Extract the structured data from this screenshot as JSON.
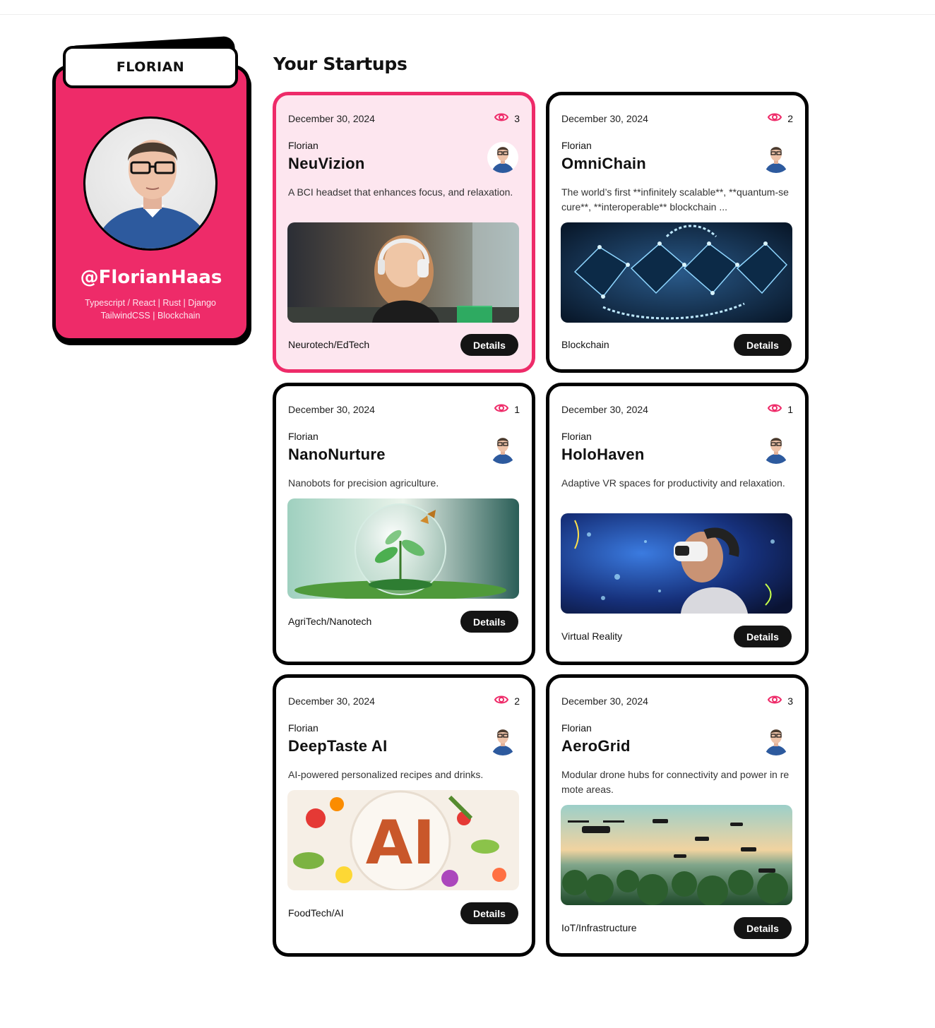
{
  "profile": {
    "tab_label": "FLORIAN",
    "handle": "@FlorianHaas",
    "bio_line1": "Typescript / React | Rust | Django",
    "bio_line2": "TailwindCSS | Blockchain",
    "avatar": "person-portrait"
  },
  "heading": "Your Startups",
  "details_label": "Details",
  "colors": {
    "accent": "#ee2b69",
    "accent_light": "#fde6ef",
    "button": "#141414"
  },
  "startups": [
    {
      "date": "December 30, 2024",
      "views": "3",
      "author": "Florian",
      "title": "NeuVizion",
      "description": "A BCI headset that enhances focus, and relaxation.",
      "category": "Neurotech/EdTech",
      "image": "woman-with-headphones",
      "active": true
    },
    {
      "date": "December 30, 2024",
      "views": "2",
      "author": "Florian",
      "title": "OmniChain",
      "description": "The world’s first **infinitely scalable**, **quantum-secure**, **interoperable** blockchain ...",
      "category": "Blockchain",
      "image": "blockchain-network",
      "active": false
    },
    {
      "date": "December 30, 2024",
      "views": "1",
      "author": "Florian",
      "title": "NanoNurture",
      "description": "Nanobots for precision agriculture.",
      "category": "AgriTech/Nanotech",
      "image": "plant-in-glass-sphere",
      "active": false
    },
    {
      "date": "December 30, 2024",
      "views": "1",
      "author": "Florian",
      "title": "HoloHaven",
      "description": "Adaptive VR spaces for productivity and relaxation.",
      "category": "Virtual Reality",
      "image": "person-with-vr-headset",
      "active": false
    },
    {
      "date": "December 30, 2024",
      "views": "2",
      "author": "Florian",
      "title": "DeepTaste AI",
      "description": "AI-powered personalized recipes and drinks.",
      "category": "FoodTech/AI",
      "image": "ai-food-plate",
      "active": false
    },
    {
      "date": "December 30, 2024",
      "views": "3",
      "author": "Florian",
      "title": "AeroGrid",
      "description": "Modular drone hubs for connectivity and power in remote areas.",
      "category": "IoT/Infrastructure",
      "image": "drones-over-forest",
      "active": false
    }
  ]
}
